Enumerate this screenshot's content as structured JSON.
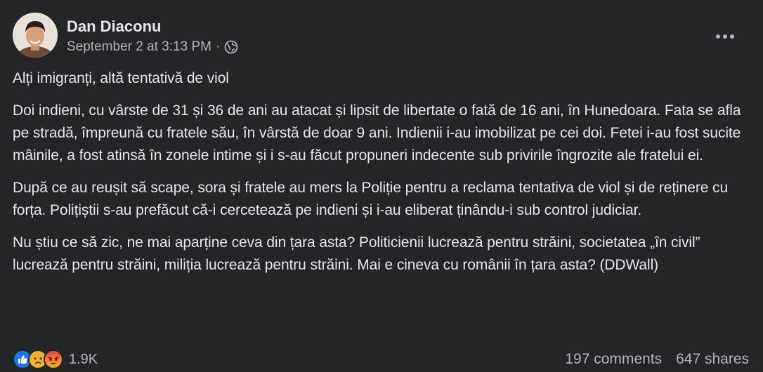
{
  "post": {
    "author": "Dan Diaconu",
    "timestamp": "September 2 at 3:13 PM",
    "separator": "·",
    "privacy_icon": "globe-icon",
    "more_icon": "more-options-icon",
    "title": "Alți imigranți, altă tentativă de viol",
    "paragraphs": [
      "Doi indieni, cu vârste de 31 și 36 de ani au atacat și lipsit de libertate o fată de 16 ani, în Hunedoara. Fata se afla pe stradă, împreună cu fratele său, în vârstă de doar 9 ani. Indienii i-au imobilizat pe cei doi. Fetei i-au fost sucite mâinile, a fost atinsă în zonele intime și i s-au făcut propuneri indecente sub privirile îngrozite ale fratelui ei.",
      "După ce au reușit să scape, sora și fratele au mers la Poliție pentru a reclama tentativa de viol și de reținere cu forța. Polițiștii s-au prefăcut că-i cercetează pe indieni și i-au eliberat ținându-i sub control judiciar.",
      "Nu știu ce să zic, ne mai aparține ceva din țara asta? Politicienii lucrează pentru străini, societatea „în civil” lucrează pentru străini, miliția lucrează pentru străini. Mai e cineva cu românii în țara asta? (DDWall)"
    ]
  },
  "footer": {
    "reactions": [
      "like-icon",
      "sad-icon",
      "angry-icon"
    ],
    "reaction_count": "1.9K",
    "comments": "197 comments",
    "shares": "647 shares"
  },
  "colors": {
    "background": "#242526",
    "primary_text": "#e4e6eb",
    "secondary_text": "#b0b3b8",
    "like_blue": "#1877f2",
    "sad_yellow": "#f7b125",
    "angry_red": "#e9710f"
  }
}
